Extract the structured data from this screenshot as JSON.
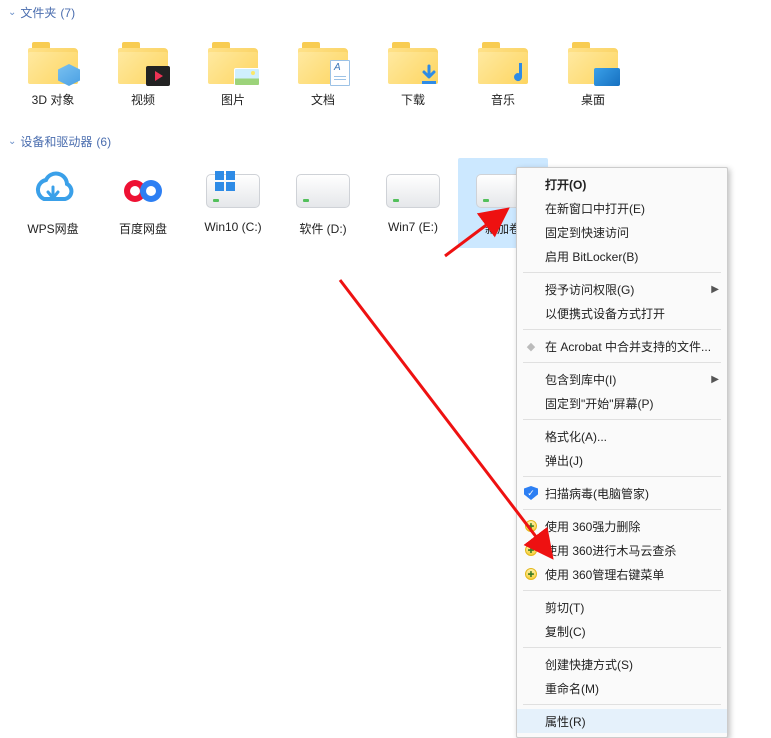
{
  "sections": {
    "folders": {
      "title": "文件夹",
      "count": "(7)"
    },
    "devices": {
      "title": "设备和驱动器",
      "count": "(6)"
    }
  },
  "folders": [
    {
      "label": "3D 对象",
      "ov": "cube"
    },
    {
      "label": "视频",
      "ov": "video"
    },
    {
      "label": "图片",
      "ov": "pic"
    },
    {
      "label": "文档",
      "ov": "doc"
    },
    {
      "label": "下载",
      "ov": "dl"
    },
    {
      "label": "音乐",
      "ov": "music"
    },
    {
      "label": "桌面",
      "ov": "screen"
    }
  ],
  "drives": [
    {
      "label": "WPS网盘",
      "type": "wps"
    },
    {
      "label": "百度网盘",
      "type": "baidu"
    },
    {
      "label": "Win10 (C:)",
      "type": "windrive"
    },
    {
      "label": "软件 (D:)",
      "type": "drive"
    },
    {
      "label": "Win7 (E:)",
      "type": "drive"
    },
    {
      "label": "新加卷",
      "type": "drive",
      "selected": true
    }
  ],
  "contextMenu": [
    {
      "label": "打开(O)",
      "bold": true
    },
    {
      "label": "在新窗口中打开(E)"
    },
    {
      "label": "固定到快速访问"
    },
    {
      "label": "启用 BitLocker(B)"
    },
    {
      "sep": true
    },
    {
      "label": "授予访问权限(G)",
      "submenu": true
    },
    {
      "label": "以便携式设备方式打开"
    },
    {
      "sep": true
    },
    {
      "label": "在 Acrobat 中合并支持的文件...",
      "icon": "acrobat"
    },
    {
      "sep": true
    },
    {
      "label": "包含到库中(I)",
      "submenu": true
    },
    {
      "label": "固定到\"开始\"屏幕(P)"
    },
    {
      "sep": true
    },
    {
      "label": "格式化(A)..."
    },
    {
      "label": "弹出(J)"
    },
    {
      "sep": true
    },
    {
      "label": "扫描病毒(电脑管家)",
      "icon": "shield"
    },
    {
      "sep": true
    },
    {
      "label": "使用 360强力删除",
      "icon": "dot"
    },
    {
      "label": "使用 360进行木马云查杀",
      "icon": "dot"
    },
    {
      "label": "使用 360管理右键菜单",
      "icon": "dot"
    },
    {
      "sep": true
    },
    {
      "label": "剪切(T)"
    },
    {
      "label": "复制(C)"
    },
    {
      "sep": true
    },
    {
      "label": "创建快捷方式(S)"
    },
    {
      "label": "重命名(M)"
    },
    {
      "sep": true
    },
    {
      "label": "属性(R)",
      "highlight": true
    }
  ]
}
